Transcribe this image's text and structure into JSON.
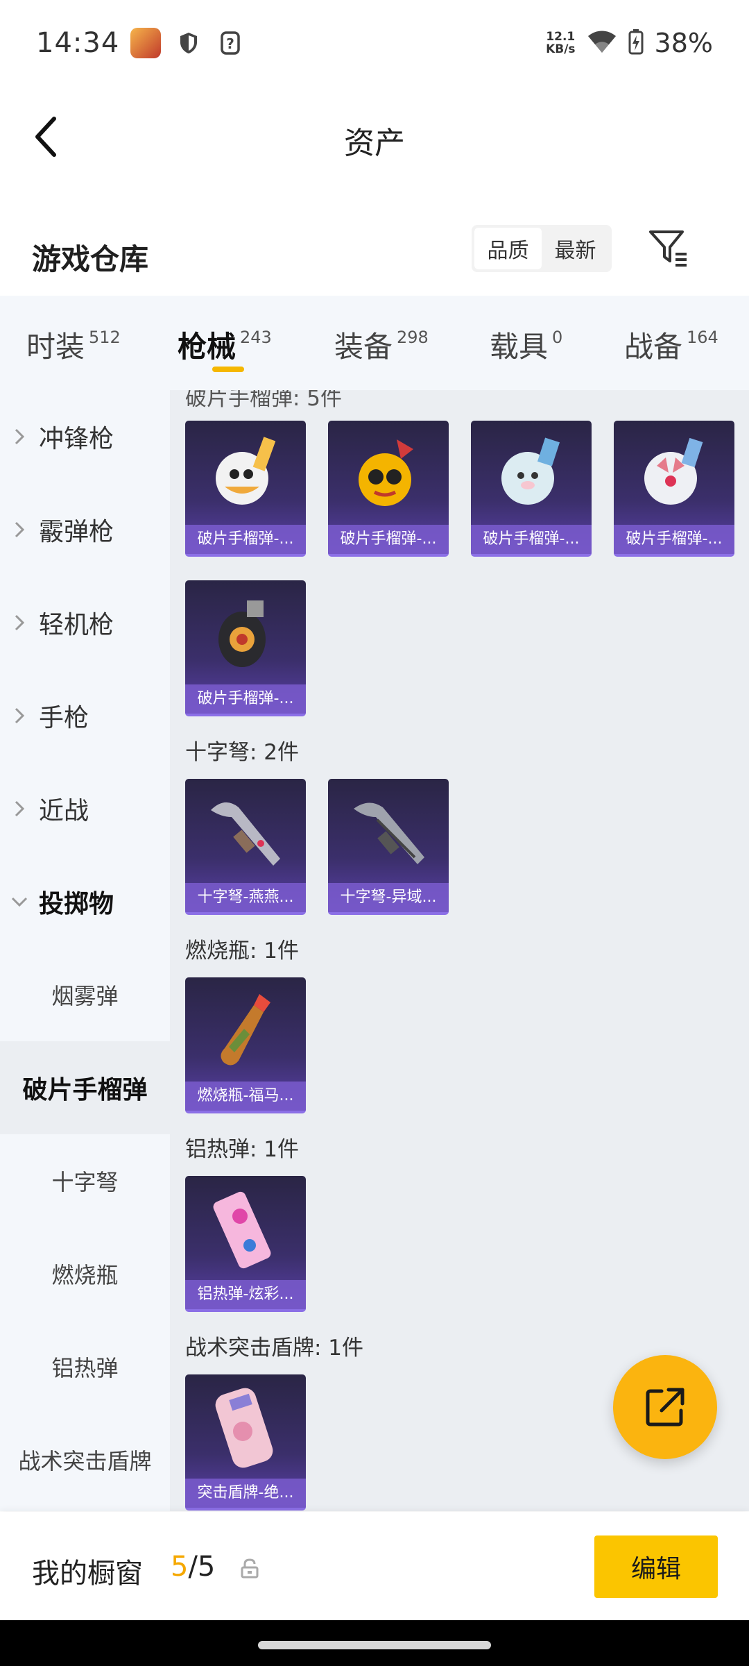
{
  "status_bar": {
    "time": "14:34",
    "speed_value": "12.1",
    "speed_unit": "KB/s",
    "battery": "38%"
  },
  "header": {
    "title": "资产"
  },
  "warehouse": {
    "title": "游戏仓库",
    "sort_options": [
      "品质",
      "最新"
    ],
    "selected_sort": "品质"
  },
  "tabs": [
    {
      "label": "时装",
      "count": "512"
    },
    {
      "label": "枪械",
      "count": "243"
    },
    {
      "label": "装备",
      "count": "298"
    },
    {
      "label": "载具",
      "count": "0"
    },
    {
      "label": "战备",
      "count": "164"
    }
  ],
  "sidebar": {
    "categories": [
      "冲锋枪",
      "霰弹枪",
      "轻机枪",
      "手枪",
      "近战",
      "投掷物"
    ],
    "subcategories": [
      "烟雾弹",
      "破片手榴弹",
      "十字弩",
      "燃烧瓶",
      "铝热弹",
      "战术突击盾牌"
    ],
    "active_sub": "破片手榴弹"
  },
  "content": {
    "partial_header": "破片手榴弹: 5件",
    "sections": [
      {
        "title": "十字弩: 2件",
        "items": [
          "十字弩-燕燕...",
          "十字弩-异域..."
        ]
      },
      {
        "title": "燃烧瓶: 1件",
        "items": [
          "燃烧瓶-福马..."
        ]
      },
      {
        "title": "铝热弹: 1件",
        "items": [
          "铝热弹-炫彩..."
        ]
      },
      {
        "title": "战术突击盾牌: 1件",
        "items": [
          "突击盾牌-绝..."
        ]
      }
    ],
    "grenade_items": [
      "破片手榴弹-...",
      "破片手榴弹-...",
      "破片手榴弹-...",
      "破片手榴弹-...",
      "破片手榴弹-..."
    ]
  },
  "showcase": {
    "title": "我的橱窗",
    "current": "5",
    "total": "/5",
    "edit_label": "编辑"
  },
  "colors": {
    "accent": "#fbc500",
    "fab": "#fbb40f",
    "card_caption": "#7a5cce"
  }
}
